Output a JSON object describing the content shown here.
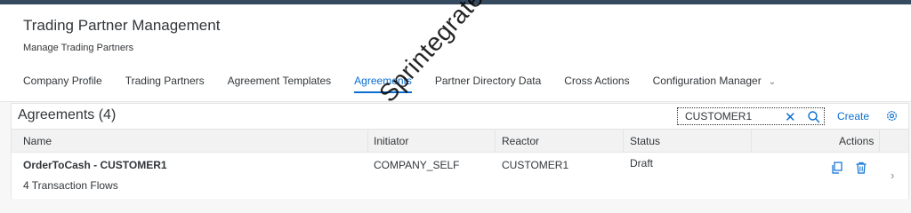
{
  "header": {
    "title": "Trading Partner Management",
    "subtitle": "Manage Trading Partners"
  },
  "tabs": [
    {
      "label": "Company Profile"
    },
    {
      "label": "Trading Partners"
    },
    {
      "label": "Agreement Templates"
    },
    {
      "label": "Agreements",
      "active": true
    },
    {
      "label": "Partner Directory Data"
    },
    {
      "label": "Cross Actions"
    },
    {
      "label": "Configuration Manager"
    }
  ],
  "panel": {
    "title": "Agreements (4)",
    "search_value": "CUSTOMER1",
    "create_label": "Create"
  },
  "table": {
    "columns": [
      "Name",
      "Initiator",
      "Reactor",
      "Status",
      "Actions"
    ],
    "rows": [
      {
        "name": "OrderToCash - CUSTOMER1",
        "detail": "4 Transaction Flows",
        "initiator": "COMPANY_SELF",
        "reactor": "CUSTOMER1",
        "status": "Draft"
      }
    ]
  },
  "watermark": "Sprintegrate",
  "colors": {
    "accent": "#0a6ed1",
    "topbar": "#354a5f"
  }
}
